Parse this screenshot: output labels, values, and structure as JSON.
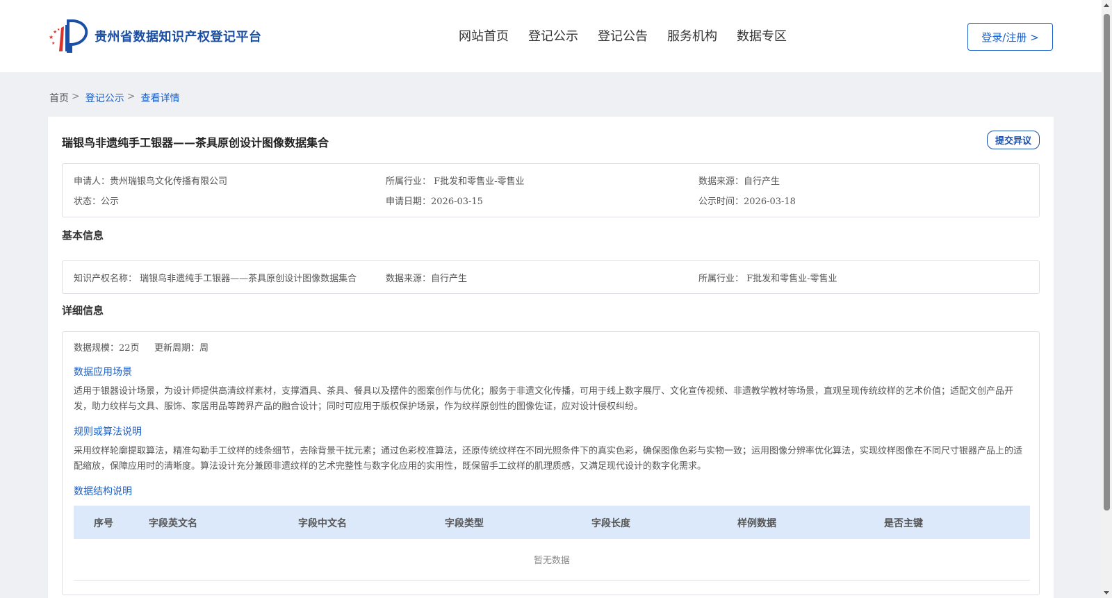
{
  "header": {
    "site_name": "贵州省数据知识产权登记平台",
    "nav": [
      "网站首页",
      "登记公示",
      "登记公告",
      "服务机构",
      "数据专区"
    ],
    "login_label": "登录/注册 >"
  },
  "breadcrumb": {
    "home": "首页",
    "sep": ">",
    "level1": "登记公示",
    "level2": "查看详情"
  },
  "detail": {
    "title": "瑞银鸟非遗纯手工银器——茶具原创设计图像数据集合",
    "objection_label": "提交异议",
    "summary": {
      "applicant": "申请人：贵州瑞银鸟文化传播有限公司",
      "industry": "所属行业： F批发和零售业-零售业",
      "source": "数据来源：自行产生",
      "status": "状态：公示",
      "apply_date": "申请日期：2026-03-15",
      "publish_time": "公示时间：2026-03-18"
    },
    "basic": {
      "heading": "基本信息",
      "ip_name": "知识产权名称： 瑞银鸟非遗纯手工银器——茶具原创设计图像数据集合",
      "source": "数据来源：自行产生",
      "industry": "所属行业： F批发和零售业-零售业"
    },
    "info": {
      "heading": "详细信息",
      "scale": "数据规模：22页",
      "cycle": "更新周期：周",
      "scene_title": "数据应用场景",
      "scene_text": "适用于银器设计场景，为设计师提供高清纹样素材，支撑酒具、茶具、餐具以及摆件的图案创作与优化；服务于非遗文化传播，可用于线上数字展厅、文化宣传视频、非遗教学教材等场景，直观呈现传统纹样的艺术价值；适配文创产品开发，助力纹样与文具、服饰、家居用品等跨界产品的融合设计；同时可应用于版权保护场景，作为纹样原创性的图像佐证，应对设计侵权纠纷。",
      "algo_title": "规则或算法说明",
      "algo_text": "采用纹样轮廓提取算法，精准勾勒手工纹样的线条细节，去除背景干扰元素；通过色彩校准算法，还原传统纹样在不同光照条件下的真实色彩，确保图像色彩与实物一致；运用图像分辨率优化算法，实现纹样图像在不同尺寸银器产品上的适配缩放，保障应用时的清晰度。算法设计充分兼顾非遗纹样的艺术完整性与数字化应用的实用性，既保留手工纹样的肌理质感，又满足现代设计的数字化需求。",
      "struct_title": "数据结构说明",
      "columns": [
        "序号",
        "字段英文名",
        "字段中文名",
        "字段类型",
        "字段长度",
        "样例数据",
        "是否主键"
      ],
      "empty_text": "暂无数据"
    }
  }
}
